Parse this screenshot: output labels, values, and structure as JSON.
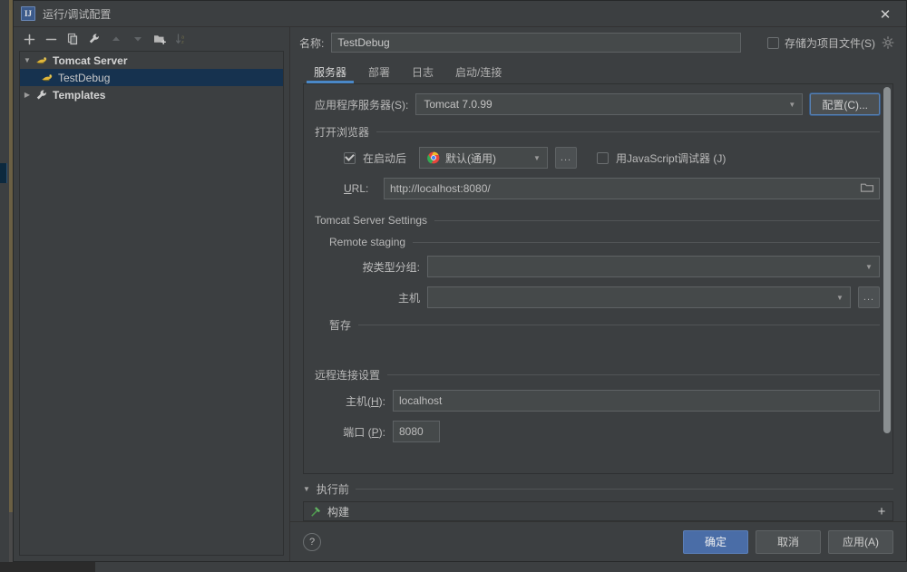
{
  "window": {
    "title": "运行/调试配置",
    "logo_text": "IJ",
    "close_label": "✕"
  },
  "toolbar": {
    "items": [
      {
        "name": "add-button",
        "glyph": "+",
        "disabled": false
      },
      {
        "name": "remove-button",
        "glyph": "−",
        "disabled": false
      },
      {
        "name": "copy-button",
        "glyph": "copy",
        "disabled": false
      },
      {
        "name": "edit-templates-button",
        "glyph": "wrench",
        "disabled": false
      },
      {
        "name": "move-up-button",
        "glyph": "▲",
        "disabled": true
      },
      {
        "name": "move-down-button",
        "glyph": "▼",
        "disabled": true
      },
      {
        "name": "move-into-folder-button",
        "glyph": "folder-plus",
        "disabled": false
      },
      {
        "name": "sort-button",
        "glyph": "sort",
        "disabled": true
      }
    ]
  },
  "tree": {
    "nodes": [
      {
        "label": "Tomcat Server",
        "level": 0,
        "expanded": true,
        "bold": true,
        "icon": "tomcat-icon",
        "selected": false
      },
      {
        "label": "TestDebug",
        "level": 1,
        "expanded": null,
        "bold": false,
        "icon": "tomcat-icon",
        "selected": true
      },
      {
        "label": "Templates",
        "level": 0,
        "expanded": false,
        "bold": true,
        "icon": "wrench-icon",
        "selected": false
      }
    ]
  },
  "name_row": {
    "label": "名称:",
    "value": "TestDebug",
    "store_as_project_file_label": "存储为项目文件(S)",
    "store_as_project_file_checked": false,
    "gear_icon": "gear-icon"
  },
  "tabs": [
    {
      "label": "服务器",
      "active": true
    },
    {
      "label": "部署",
      "active": false
    },
    {
      "label": "日志",
      "active": false
    },
    {
      "label": "启动/连接",
      "active": false
    }
  ],
  "server_tab": {
    "app_server": {
      "label": "应用程序服务器(S):",
      "value": "Tomcat 7.0.99",
      "configure_button": "配置(C)..."
    },
    "open_browser": {
      "group_title": "打开浏览器",
      "after_launch_label": "在启动后",
      "after_launch_checked": true,
      "browser_value": "默认(通用)",
      "browser_icon": "chrome-icon",
      "browse_button": "...",
      "js_debugger_label": "用JavaScript调试器 (J)",
      "js_debugger_checked": false,
      "url_label": "URL:",
      "url_value": "http://localhost:8080/",
      "url_folder_icon": "folder-icon"
    },
    "tomcat_settings": {
      "group_title": "Tomcat Server Settings",
      "remote_staging": {
        "group_title": "Remote staging",
        "group_by_type_label": "按类型分组:",
        "group_by_type_value": "",
        "host_label": "主机",
        "host_value": "",
        "host_browse_button": "...",
        "staging_title": "暂存"
      }
    },
    "remote_connection": {
      "group_title": "远程连接设置",
      "host_label": "主机(H):",
      "host_value": "localhost",
      "port_label": "端口 (P):",
      "port_value": "8080"
    }
  },
  "before_launch": {
    "title": "执行前",
    "expanded": true,
    "items": [
      {
        "label": "构建",
        "icon": "build-hammer-icon"
      }
    ],
    "add_button": "+"
  },
  "footer": {
    "help_label": "?",
    "ok_label": "确定",
    "cancel_label": "取消",
    "apply_label": "应用(A)"
  },
  "colors": {
    "dialog_bg": "#3c3f41",
    "accent_blue": "#4a88c7",
    "primary_button": "#4a6da7",
    "selection": "#16324f",
    "field_bg": "#45494a",
    "text": "#bbbbbb"
  }
}
